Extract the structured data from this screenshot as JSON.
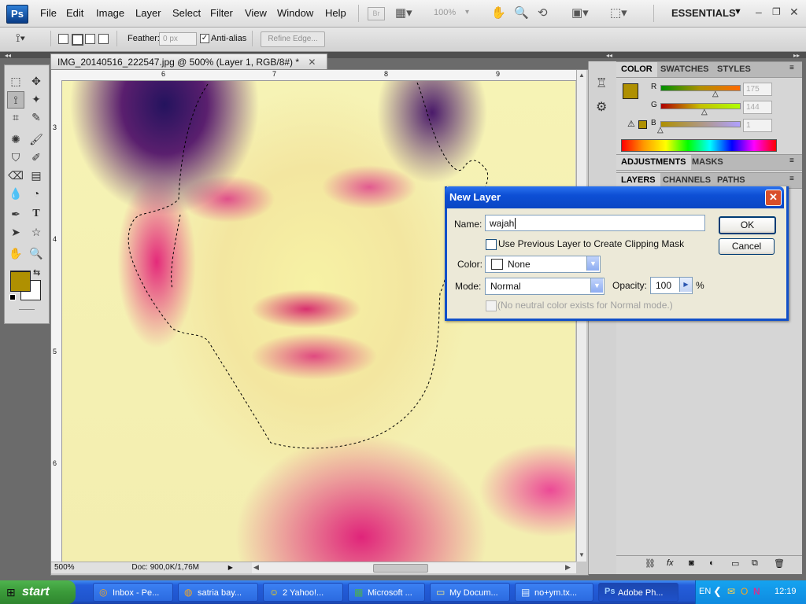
{
  "app": {
    "logo": "Ps",
    "workspace": "ESSENTIALS",
    "zoom_dropdown": "100%"
  },
  "menu": [
    "File",
    "Edit",
    "Image",
    "Layer",
    "Select",
    "Filter",
    "View",
    "Window",
    "Help"
  ],
  "options_bar": {
    "feather_label": "Feather:",
    "feather_value": "0 px",
    "antialias_label": "Anti-alias",
    "antialias_checked": true,
    "refine_edge_label": "Refine Edge..."
  },
  "document": {
    "tab_title": "IMG_20140516_222547.jpg @ 500% (Layer 1, RGB/8#) *",
    "ruler_top": [
      "6",
      "7",
      "8",
      "9"
    ],
    "ruler_left": [
      "3",
      "4",
      "5",
      "6"
    ],
    "zoom": "500%",
    "doc_info": "Doc: 900,0K/1,76M"
  },
  "panels": {
    "color_tabs": [
      "COLOR",
      "SWATCHES",
      "STYLES"
    ],
    "channels": [
      {
        "label": "R",
        "value": "175",
        "fraction": 0.686
      },
      {
        "label": "G",
        "value": "144",
        "fraction": 0.565
      },
      {
        "label": "B",
        "value": "1",
        "fraction": 0.004
      }
    ],
    "foreground_color": "#af9001",
    "adjust_tabs": [
      "ADJUSTMENTS",
      "MASKS"
    ],
    "layer_tabs": [
      "LAYERS",
      "CHANNELS",
      "PATHS"
    ]
  },
  "dialog": {
    "title": "New Layer",
    "name_label": "Name:",
    "name_value": "wajah",
    "clip_label": "Use Previous Layer to Create Clipping Mask",
    "color_label": "Color:",
    "color_value": "None",
    "mode_label": "Mode:",
    "mode_value": "Normal",
    "opacity_label": "Opacity:",
    "opacity_value": "100",
    "opacity_unit": "%",
    "neutral_label": "(No neutral color exists for Normal mode.)",
    "ok_label": "OK",
    "cancel_label": "Cancel"
  },
  "taskbar": {
    "start_label": "start",
    "tasks": [
      "Inbox - Pe...",
      "satria bay...",
      "2 Yahoo!...",
      "Microsoft ...",
      "My Docum...",
      "no+ym.tx...",
      "Adobe Ph..."
    ],
    "lang": "EN",
    "clock": "12:19"
  }
}
